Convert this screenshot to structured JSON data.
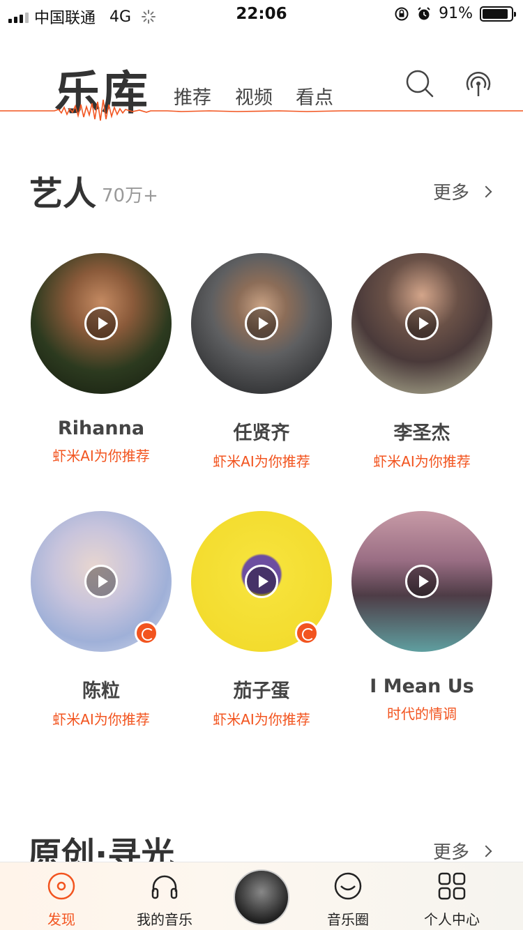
{
  "status": {
    "carrier": "中国联通",
    "network": "4G",
    "time": "22:06",
    "battery": "91%",
    "battery_level": 0.91
  },
  "header": {
    "title": "乐库",
    "tabs": [
      "推荐",
      "视频",
      "看点"
    ]
  },
  "artists_section": {
    "title": "艺人",
    "count": "70万+",
    "more": "更多"
  },
  "artists": [
    {
      "name": "Rihanna",
      "sub": "虾米AI为你推荐"
    },
    {
      "name": "任贤齐",
      "sub": "虾米AI为你推荐"
    },
    {
      "name": "李圣杰",
      "sub": "虾米AI为你推荐"
    },
    {
      "name": "陈粒",
      "sub": "虾米AI为你推荐"
    },
    {
      "name": "茄子蛋",
      "sub": "虾米AI为你推荐"
    },
    {
      "name": "I Mean Us",
      "sub": "时代的情调"
    }
  ],
  "original_section": {
    "title": "原创·寻光",
    "more": "更多"
  },
  "tabbar": {
    "items": [
      "发现",
      "我的音乐",
      "音乐圈",
      "个人中心"
    ]
  },
  "colors": {
    "accent": "#f2541f"
  }
}
